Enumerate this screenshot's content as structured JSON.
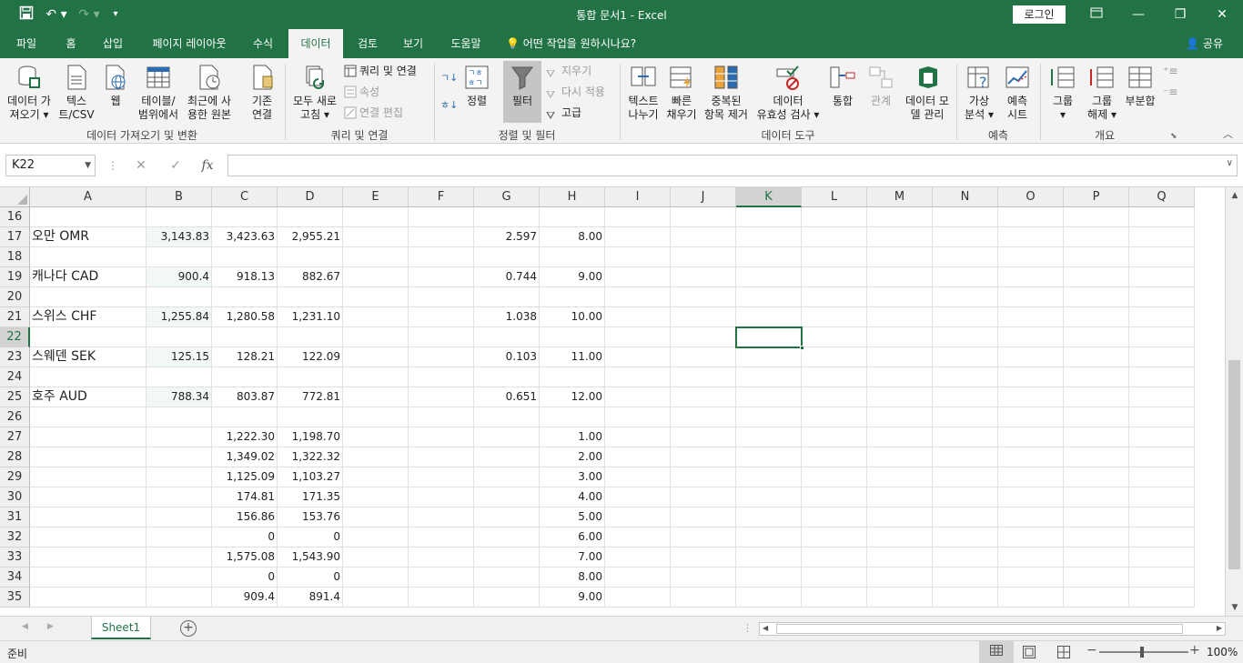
{
  "title_bar": {
    "title": "통합 문서1  -  Excel",
    "login_label": "로그인"
  },
  "tabs": [
    {
      "label": "파일",
      "active": false
    },
    {
      "label": "홈",
      "active": false
    },
    {
      "label": "삽입",
      "active": false
    },
    {
      "label": "페이지 레이아웃",
      "active": false
    },
    {
      "label": "수식",
      "active": false
    },
    {
      "label": "데이터",
      "active": true
    },
    {
      "label": "검토",
      "active": false
    },
    {
      "label": "보기",
      "active": false
    },
    {
      "label": "도움말",
      "active": false
    }
  ],
  "tell_me": "어떤 작업을 원하시나요?",
  "share_label": "공유",
  "ribbon": {
    "get_data": {
      "line1": "데이터 가",
      "line2": "져오기"
    },
    "text_csv": {
      "line1": "텍스",
      "line2": "트/CSV"
    },
    "web": {
      "line1": "웹"
    },
    "from_table": {
      "line1": "테이블/",
      "line2": "범위에서"
    },
    "recent_sources": {
      "line1": "최근에 사",
      "line2": "용한 원본"
    },
    "existing_conn": {
      "line1": "기존",
      "line2": "연결"
    },
    "group_get_transform": "데이터 가져오기 및 변환",
    "refresh_all": {
      "line1": "모두 새로",
      "line2": "고침"
    },
    "queries_connections": "쿼리 및 연결",
    "properties": "속성",
    "edit_links": "연결 편집",
    "group_queries": "쿼리 및 연결",
    "sort_asc": "ㄱ↓",
    "sort_desc": "ㅎ↓",
    "sort": {
      "line1": "정렬"
    },
    "filter": {
      "line1": "필터"
    },
    "clear": "지우기",
    "reapply": "다시 적용",
    "advanced": "고급",
    "group_sort_filter": "정렬 및 필터",
    "text_to_columns": {
      "line1": "텍스트",
      "line2": "나누기"
    },
    "flash_fill": {
      "line1": "빠른",
      "line2": "채우기"
    },
    "remove_duplicates": {
      "line1": "중복된",
      "line2": "항목 제거"
    },
    "data_validation": {
      "line1": "데이터",
      "line2": "유효성 검사"
    },
    "consolidate": {
      "line1": "통합"
    },
    "relationships": {
      "line1": "관계"
    },
    "data_model": {
      "line1": "데이터 모",
      "line2": "델 관리"
    },
    "group_data_tools": "데이터 도구",
    "what_if": {
      "line1": "가상",
      "line2": "분석"
    },
    "forecast_sheet": {
      "line1": "예측",
      "line2": "시트"
    },
    "group_forecast": "예측",
    "group_btn": {
      "line1": "그룹"
    },
    "ungroup_btn": {
      "line1": "그룹",
      "line2": "해제"
    },
    "subtotal": {
      "line1": "부분합"
    },
    "group_outline": "개요"
  },
  "formula_bar": {
    "name_box": "K22",
    "cancel": "✕",
    "enter": "✓",
    "fx": "fx",
    "formula": ""
  },
  "columns": [
    "A",
    "B",
    "C",
    "D",
    "E",
    "F",
    "G",
    "H",
    "I",
    "J",
    "K",
    "L",
    "M",
    "N",
    "O",
    "P",
    "Q"
  ],
  "selected_column": "K",
  "selected_row": "22",
  "rows": [
    {
      "num": "16",
      "cells": {}
    },
    {
      "num": "17",
      "cells": {
        "A": "오만 OMR",
        "B": "3,143.83",
        "C": "3,423.63",
        "D": "2,955.21",
        "G": "2.597",
        "H": "8.00"
      }
    },
    {
      "num": "18",
      "cells": {}
    },
    {
      "num": "19",
      "cells": {
        "A": "캐나다 CAD",
        "B": "900.4",
        "C": "918.13",
        "D": "882.67",
        "G": "0.744",
        "H": "9.00"
      }
    },
    {
      "num": "20",
      "cells": {}
    },
    {
      "num": "21",
      "cells": {
        "A": "스위스 CHF",
        "B": "1,255.84",
        "C": "1,280.58",
        "D": "1,231.10",
        "G": "1.038",
        "H": "10.00"
      }
    },
    {
      "num": "22",
      "cells": {}
    },
    {
      "num": "23",
      "cells": {
        "A": "스웨덴 SEK",
        "B": "125.15",
        "C": "128.21",
        "D": "122.09",
        "G": "0.103",
        "H": "11.00"
      }
    },
    {
      "num": "24",
      "cells": {}
    },
    {
      "num": "25",
      "cells": {
        "A": "호주 AUD",
        "B": "788.34",
        "C": "803.87",
        "D": "772.81",
        "G": "0.651",
        "H": "12.00"
      }
    },
    {
      "num": "26",
      "cells": {}
    },
    {
      "num": "27",
      "cells": {
        "C": "1,222.30",
        "D": "1,198.70",
        "H": "1.00"
      }
    },
    {
      "num": "28",
      "cells": {
        "C": "1,349.02",
        "D": "1,322.32",
        "H": "2.00"
      }
    },
    {
      "num": "29",
      "cells": {
        "C": "1,125.09",
        "D": "1,103.27",
        "H": "3.00"
      }
    },
    {
      "num": "30",
      "cells": {
        "C": "174.81",
        "D": "171.35",
        "H": "4.00"
      }
    },
    {
      "num": "31",
      "cells": {
        "C": "156.86",
        "D": "153.76",
        "H": "5.00"
      }
    },
    {
      "num": "32",
      "cells": {
        "C": "0",
        "D": "0",
        "H": "6.00"
      }
    },
    {
      "num": "33",
      "cells": {
        "C": "1,575.08",
        "D": "1,543.90",
        "H": "7.00"
      }
    },
    {
      "num": "34",
      "cells": {
        "C": "0",
        "D": "0",
        "H": "8.00"
      }
    },
    {
      "num": "35",
      "cells": {
        "C": "909.4",
        "D": "891.4",
        "H": "9.00"
      }
    }
  ],
  "sheet_tabs": [
    {
      "label": "Sheet1",
      "active": true
    }
  ],
  "status": {
    "ready": "준비",
    "zoom": "100%"
  },
  "colors": {
    "accent": "#217346",
    "ribbon_bg": "#f3f3f3",
    "b_column_fill": "#f2f8f4"
  }
}
